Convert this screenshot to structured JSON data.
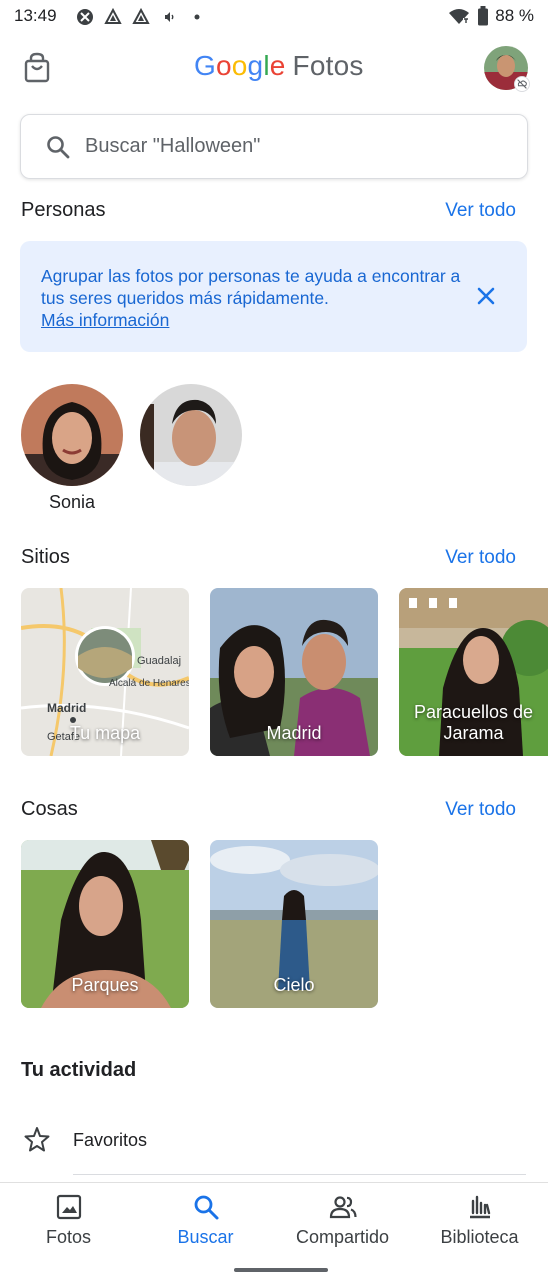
{
  "status_bar": {
    "time": "13:49",
    "battery": "88 %"
  },
  "app_bar": {
    "brand_letters": [
      "G",
      "o",
      "o",
      "g",
      "l",
      "e"
    ],
    "product": "Fotos"
  },
  "search": {
    "placeholder": "Buscar \"Halloween\""
  },
  "people": {
    "title": "Personas",
    "see_all": "Ver todo",
    "banner_text": "Agrupar las fotos por personas te ayuda a encontrar a tus seres queridos más rápidamente.",
    "banner_link": "Más información",
    "items": [
      {
        "name": "Sonia"
      },
      {
        "name": ""
      }
    ]
  },
  "places": {
    "title": "Sitios",
    "see_all": "Ver todo",
    "items": [
      {
        "label": "Tu mapa"
      },
      {
        "label": "Madrid"
      },
      {
        "label": "Paracuellos de Jarama"
      }
    ],
    "map_labels": {
      "city1": "Madrid",
      "city2": "Guadalaj",
      "city3": "Alcalá de Henares",
      "city4": "Getafe"
    }
  },
  "things": {
    "title": "Cosas",
    "see_all": "Ver todo",
    "items": [
      {
        "label": "Parques"
      },
      {
        "label": "Cielo"
      }
    ]
  },
  "activity": {
    "title": "Tu actividad",
    "favorites": "Favoritos"
  },
  "bottom_nav": [
    {
      "label": "Fotos",
      "icon": "photo-icon"
    },
    {
      "label": "Buscar",
      "icon": "search-icon",
      "active": true
    },
    {
      "label": "Compartido",
      "icon": "people-icon"
    },
    {
      "label": "Biblioteca",
      "icon": "library-icon"
    }
  ],
  "colors": {
    "accent": "#1a73e8",
    "banner_bg": "#e8f0fe",
    "text": "#202124"
  }
}
